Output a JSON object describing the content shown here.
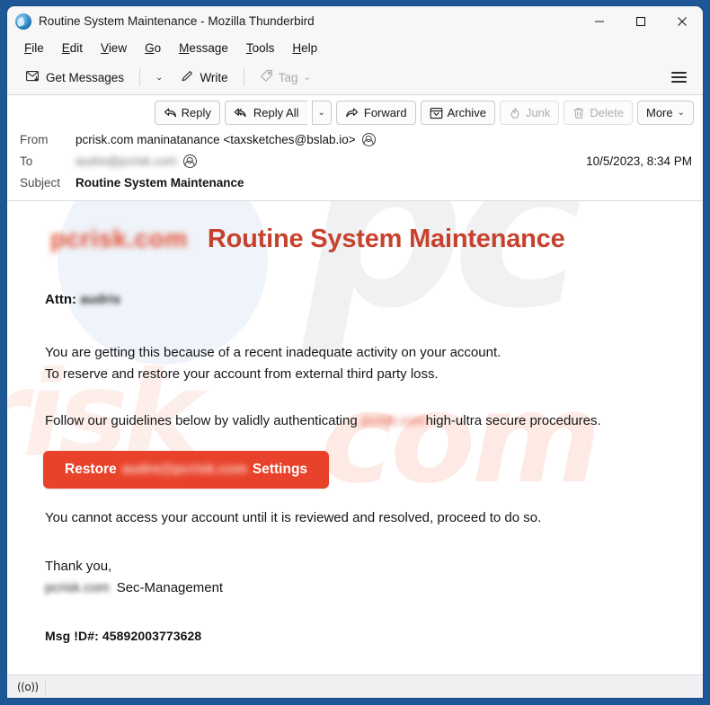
{
  "window": {
    "title": "Routine System Maintenance - Mozilla Thunderbird",
    "logo_icon": "thunderbird-logo-icon",
    "controls": {
      "minimize": "minimize-icon",
      "maximize": "maximize-icon",
      "close": "close-icon"
    }
  },
  "menubar": {
    "items": [
      {
        "label": "File",
        "accel": "F"
      },
      {
        "label": "Edit",
        "accel": "E"
      },
      {
        "label": "View",
        "accel": "V"
      },
      {
        "label": "Go",
        "accel": "G"
      },
      {
        "label": "Message",
        "accel": "M"
      },
      {
        "label": "Tools",
        "accel": "T"
      },
      {
        "label": "Help",
        "accel": "H"
      }
    ]
  },
  "toolbar": {
    "get_messages_label": "Get Messages",
    "get_messages_icon": "envelope-download-icon",
    "get_messages_caret": "⌄",
    "write_label": "Write",
    "write_icon": "pencil-icon",
    "tag_label": "Tag",
    "tag_icon": "tag-icon",
    "tag_caret": "⌄",
    "app_menu_icon": "hamburger-menu-icon"
  },
  "message_actions": {
    "reply": "Reply",
    "reply_all": "Reply All",
    "reply_all_caret": "⌄",
    "forward": "Forward",
    "archive": "Archive",
    "junk": "Junk",
    "delete": "Delete",
    "more": "More",
    "more_caret": "⌄"
  },
  "message_header": {
    "from_label": "From",
    "from_value": "pcrisk.com maninatanance <taxsketches@bslab.io>",
    "to_label": "To",
    "to_value_redacted": "audre@pcrisk.com",
    "subject_label": "Subject",
    "subject_value": "Routine System Maintenance",
    "date": "10/5/2023, 8:34 PM",
    "contact_icon": "contact-avatar-icon"
  },
  "email_body": {
    "logo_redacted": "pcrisk.com",
    "heading": "Routine System Maintenance",
    "attn_label": "Attn:",
    "attn_value_redacted": "audris",
    "paragraph_1_line_1": "You are getting this because of a recent inadequate activity on your account.",
    "paragraph_1_line_2": "To reserve and restore your account from external third party loss.",
    "follow_prefix": "Follow our guidelines below by validly authenticating ",
    "follow_redacted": "pcrisk.com",
    "follow_suffix": "high-ultra secure procedures.",
    "button_prefix": "Restore",
    "button_redacted": "audre@pcrisk.com",
    "button_suffix": "Settings",
    "paragraph_cannot": "You cannot access your account until it is reviewed and resolved, proceed to do so.",
    "thank_you": "Thank you,",
    "signature_redacted": "pcrisk.com",
    "signature_text": "Sec-Management",
    "msg_id": "Msg !D#: 45892003773628"
  },
  "watermark": {
    "top": "pc",
    "middle": "risk",
    "bottom": ".com"
  },
  "statusbar": {
    "online_indicator": "((o))",
    "online_icon": "broadcast-online-icon"
  },
  "colors": {
    "desktop_blue": "#1d5795",
    "heading_red": "#c7422e",
    "button_red": "#e8422a",
    "toolbar_bg": "#f7f7f8"
  }
}
